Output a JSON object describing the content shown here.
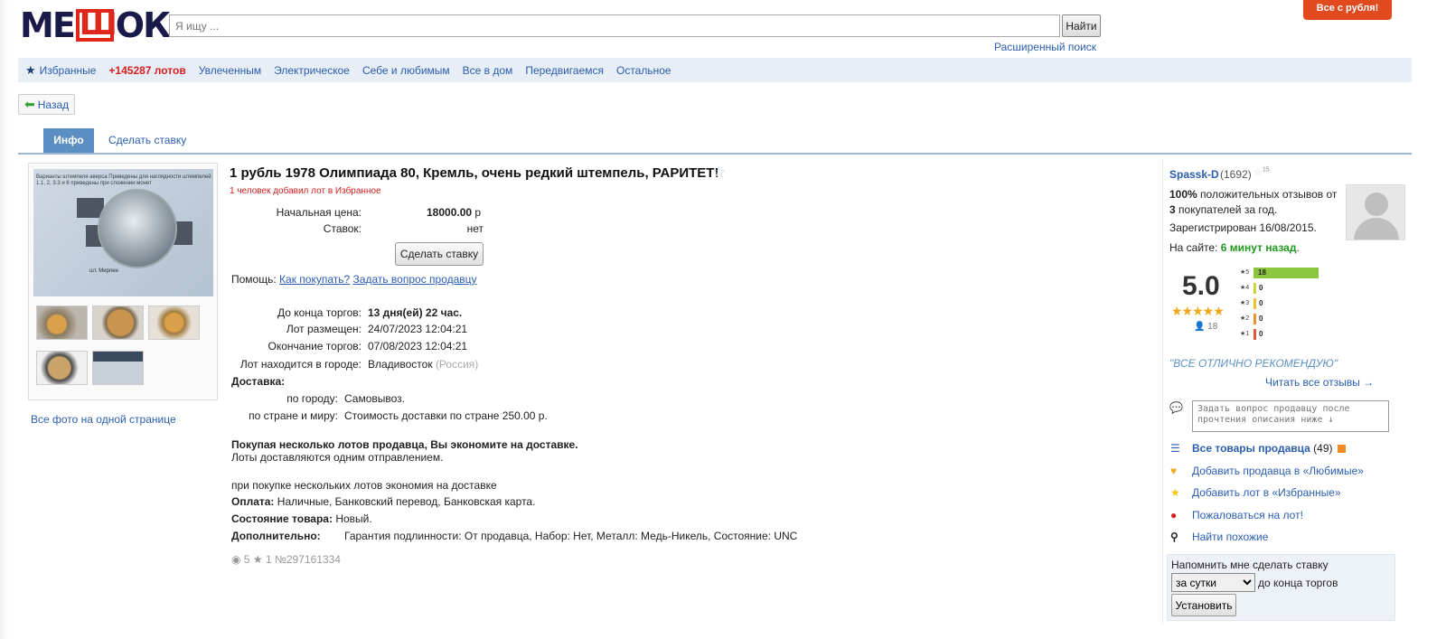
{
  "header": {
    "logo": "МЕШОК",
    "search_placeholder": "Я ищу ...",
    "search_button": "Найти",
    "advanced_search": "Расширенный поиск",
    "promo_badge": "Все с рубля!"
  },
  "nav": {
    "favorites": "Избранные",
    "lots_count": "+145287 лотов",
    "items": [
      "Увлеченным",
      "Электрическое",
      "Себе и любимым",
      "Все в дом",
      "Передвигаемся",
      "Остальное"
    ]
  },
  "back_button": "Назад",
  "tabs": {
    "info": "Инфо",
    "make_bid": "Сделать ставку"
  },
  "gallery": {
    "photo_caption": "Варианты штемпеля аверса\nПриведены для наглядности штемпелей 1.1, 2, 3.3 и 6 приведены при сложении монет",
    "photo_label": "шт. Мирлен",
    "all_photos_link": "Все фото на одной странице"
  },
  "lot": {
    "title": "1 рубль 1978 Олимпиада 80, Кремль, очень редкий штемпель, РАРИТЕТ!",
    "favorited_note": "1 человек добавил лот в Избранное",
    "start_price_label": "Начальная цена:",
    "start_price_value": "18000.00",
    "currency": "р",
    "bids_label": "Ставок:",
    "bids_value": "нет",
    "bid_button": "Сделать ставку",
    "help_label": "Помощь:",
    "help_link1": "Как покупать?",
    "help_link2": "Задать вопрос продавцу",
    "ends_in_label": "До конца торгов:",
    "ends_in_value": "13 дня(ей) 22 час.",
    "placed_label": "Лот размещен:",
    "placed_value": "24/07/2023 12:04:21",
    "ending_label": "Окончание торгов:",
    "ending_value": "07/08/2023 12:04:21",
    "city_label": "Лот находится в городе:",
    "city_value": "Владивосток",
    "country": "(Россия)",
    "delivery_label": "Доставка:",
    "delivery_city_label": "по городу:",
    "delivery_city_value": "Самовывоз.",
    "delivery_world_label": "по стране и миру:",
    "delivery_world_value": "Стоимость доставки по стране 250.00 р.",
    "savings_bold": "Покупая несколько лотов продавца, Вы экономите на доставке.",
    "savings_note": "Лоты доставляются одним отправлением.",
    "multi_note": "при покупке нескольких лотов экономия на доставке",
    "payment_label": "Оплата:",
    "payment_value": "Наличные, Банковский перевод, Банковская карта.",
    "condition_label": "Состояние товара:",
    "condition_value": "Новый.",
    "extra_label": "Дополнительно:",
    "extra_value": "Гарантия подлинности: От продавца, Набор: Нет, Металл: Медь-Никель, Состояние: UNC",
    "views": "5",
    "stars": "1",
    "lot_number": "№297161334"
  },
  "seller": {
    "name": "Spassk-D",
    "rank": "(1692)",
    "badge": "15",
    "positive_pct": "100%",
    "positive_text": "положительных отзывов от",
    "buyers": "3",
    "buyers_text": "покупателей за год.",
    "registered": "Зарегистрирован 16/08/2015.",
    "online_label": "На сайте:",
    "online_value": "6 минут назад",
    "rating": "5.0",
    "reviewers": "18",
    "rating_bars": [
      {
        "star": "5",
        "count": 18,
        "color": "#8cc63f"
      },
      {
        "star": "4",
        "count": 0,
        "color": "#c7d93a"
      },
      {
        "star": "3",
        "count": 0,
        "color": "#f2c12e"
      },
      {
        "star": "2",
        "count": 0,
        "color": "#f0922c"
      },
      {
        "star": "1",
        "count": 0,
        "color": "#e0573a"
      }
    ],
    "review_quote": "\"ВСЕ ОТЛИЧНО РЕКОМЕНДУЮ\"",
    "read_all": "Читать все отзывы →",
    "ask_placeholder": "Задать вопрос продавцу после прочтения описания ниже ↓",
    "all_items": "Все товары продавца",
    "all_items_count": "(49)",
    "add_seller_fav": "Добавить продавца в «Любимые»",
    "add_lot_fav": "Добавить лот в «Избранные»",
    "report": "Пожаловаться на лот!",
    "find_similar": "Найти похожие",
    "remind_label": "Напомнить мне сделать ставку",
    "remind_option": "за сутки",
    "remind_suffix": "до конца торгов",
    "remind_button": "Установить"
  },
  "colors": {
    "accent": "#2a5db0",
    "promo": "#e04a1e",
    "alert": "#d31f1f",
    "tab": "#5b8fc4"
  }
}
